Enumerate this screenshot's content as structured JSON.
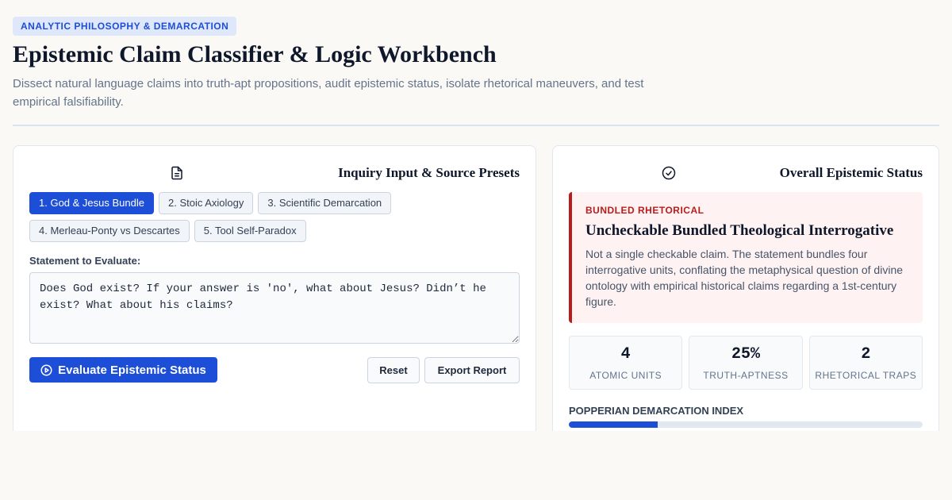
{
  "header": {
    "badge": "ANALYTIC PHILOSOPHY & DEMARCATION",
    "title": "Epistemic Claim Classifier & Logic Workbench",
    "subtitle": "Dissect natural language claims into truth-apt propositions, audit epistemic status, isolate rhetorical maneuvers, and test empirical falsifiability."
  },
  "input_panel": {
    "heading": "Inquiry Input & Source Presets",
    "icon": "document-icon",
    "presets": [
      {
        "label": "1. God & Jesus Bundle",
        "active": true
      },
      {
        "label": "2. Stoic Axiology",
        "active": false
      },
      {
        "label": "3. Scientific Demarcation",
        "active": false
      },
      {
        "label": "4. Merleau-Ponty vs Descartes",
        "active": false
      },
      {
        "label": "5. Tool Self-Paradox",
        "active": false
      }
    ],
    "field_label": "Statement to Evaluate:",
    "statement": "Does God exist? If your answer is 'no', what about Jesus? Didn’t he exist? What about his claims?",
    "evaluate_label": "Evaluate Epistemic Status",
    "reset_label": "Reset",
    "export_label": "Export Report"
  },
  "status_panel": {
    "heading": "Overall Epistemic Status",
    "icon": "check-circle-icon",
    "kicker": "BUNDLED RHETORICAL",
    "verdict": "Uncheckable Bundled Theological Interrogative",
    "description": "Not a single checkable claim. The statement bundles four interrogative units, conflating the metaphysical question of divine ontology with empirical historical claims regarding a 1st-century figure.",
    "stats": [
      {
        "value": "4",
        "label": "ATOMIC UNITS"
      },
      {
        "value": "25%",
        "label": "TRUTH-APTNESS"
      },
      {
        "value": "2",
        "label": "RHETORICAL TRAPS"
      }
    ],
    "index_label": "POPPERIAN DEMARCATION INDEX",
    "index_value": 0.25
  },
  "colors": {
    "accent": "#1d4ed8",
    "alert": "#b91c1c",
    "alert_bg": "#fef2f2"
  }
}
